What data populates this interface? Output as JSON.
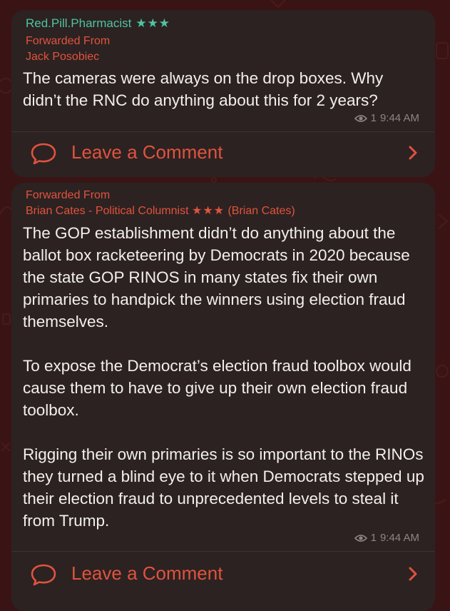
{
  "message1": {
    "sender": "Red.Pill.Pharmacist",
    "sender_stars": "★★★",
    "forwarded_label": "Forwarded From",
    "forwarded_source": "Jack Posobiec",
    "text": "The cameras were always on the drop boxes. Why didn’t the RNC do anything about this for 2 years?",
    "views": "1",
    "time": "9:44 AM",
    "comment_label": "Leave a Comment"
  },
  "message2": {
    "forwarded_label": "Forwarded From",
    "forwarded_source": "Brian Cates - Political Columnist",
    "forwarded_stars": "★★★",
    "forwarded_handle": "(Brian Cates)",
    "text": "The GOP establishment didn’t do anything about the ballot box racketeering by Democrats in 2020 because the state GOP RINOS in many states fix their own primaries to handpick the winners using election fraud themselves.\n\nTo expose the Democrat’s election fraud toolbox would cause them to have to give up their own election fraud toolbox.\n\nRigging their own primaries is so important to the RINOs they turned a blind eye to it when Democrats stepped up their election fraud to unprecedented levels to steal it from Trump.",
    "views": "1",
    "time": "9:44 AM",
    "comment_label": "Leave a Comment"
  },
  "colors": {
    "background": "#3a1414",
    "bubble": "#2c2221",
    "sender": "#4fc3a1",
    "accent": "#e0533f",
    "text": "#f2efee",
    "meta": "#8e8583"
  },
  "icons": {
    "views": "eye-icon",
    "comment": "comment-bubble-icon",
    "chevron": "chevron-right-icon"
  }
}
